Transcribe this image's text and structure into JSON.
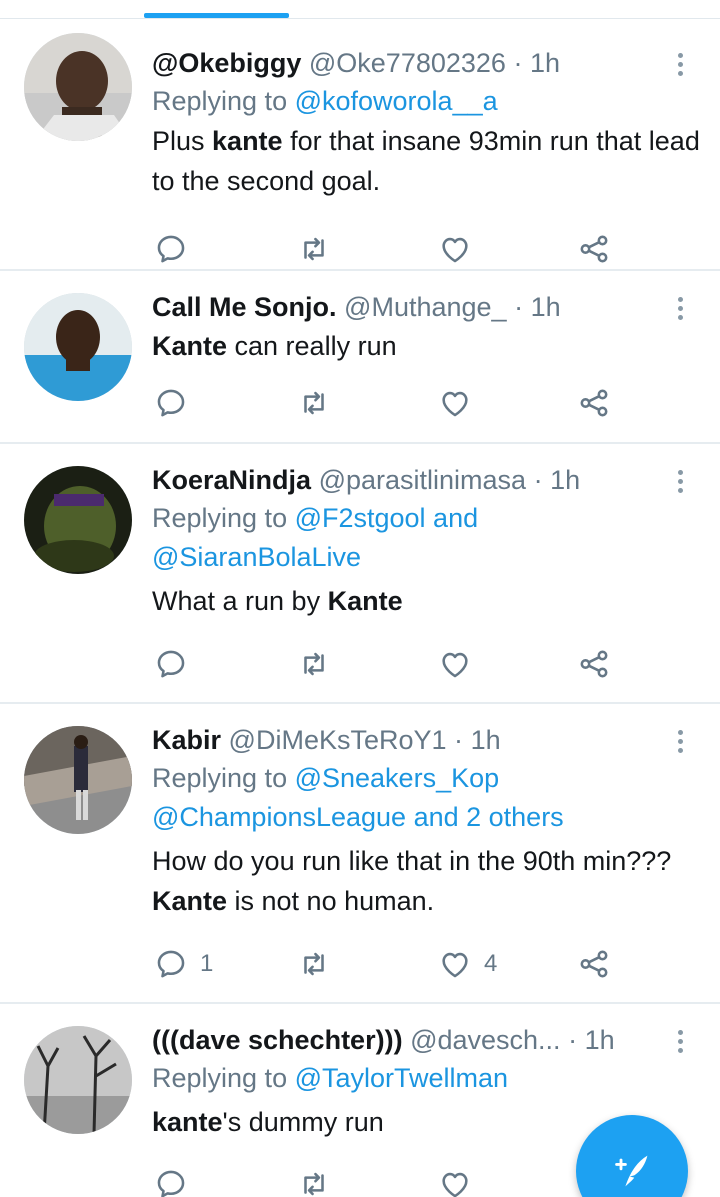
{
  "tweets": [
    {
      "name": "@Okebiggy",
      "handle": "@Oke77802326",
      "sep": "·",
      "time": "1h",
      "reply_prefix": "Replying to ",
      "reply_mentions_1": "@kofoworola__a",
      "reply_mentions_2": "",
      "body_pre": "Plus ",
      "body_bold": "kante",
      "body_post": " for that insane 93min run that lead to the second goal.",
      "reply_count": "",
      "like_count": ""
    },
    {
      "name": "Call Me Sonjo.",
      "handle": "@Muthange_",
      "sep": "·",
      "time": "1h",
      "reply_prefix": "",
      "reply_mentions_1": "",
      "reply_mentions_2": "",
      "body_pre": "",
      "body_bold": "Kante",
      "body_post": " can really run",
      "reply_count": "",
      "like_count": ""
    },
    {
      "name": "KoeraNindja",
      "handle": "@parasitlinimasa",
      "sep": "·",
      "time": "1h",
      "reply_prefix": "Replying to ",
      "reply_mentions_1": "@F2stgool and",
      "reply_mentions_2": "@SiaranBolaLive",
      "body_pre": "What a run by ",
      "body_bold": "Kante",
      "body_post": "",
      "reply_count": "",
      "like_count": ""
    },
    {
      "name": "Kabir",
      "handle": "@DiMeKsTeRoY1",
      "sep": "·",
      "time": "1h",
      "reply_prefix": "Replying to ",
      "reply_mentions_1": "@Sneakers_Kop",
      "reply_mentions_2": "@ChampionsLeague and 2 others",
      "body_pre": "How do you run like that in the 90th min??? ",
      "body_bold": "Kante",
      "body_post": " is not no human.",
      "reply_count": "1",
      "like_count": "4"
    },
    {
      "name": "(((dave schechter)))",
      "handle": "@davesch...",
      "sep": "·",
      "time": "1h",
      "reply_prefix": "Replying to ",
      "reply_mentions_1": "@TaylorTwellman",
      "reply_mentions_2": "",
      "body_pre": "",
      "body_bold": "kante",
      "body_post": "'s dummy run",
      "reply_count": "",
      "like_count": ""
    }
  ],
  "icons": {
    "reply": "reply-icon",
    "retweet": "retweet-icon",
    "like": "heart-icon",
    "share": "share-icon",
    "more": "more-vertical-icon",
    "compose": "compose-tweet-icon"
  },
  "colors": {
    "accent": "#1da1f2",
    "mention": "#1b95e0",
    "muted": "#657786",
    "text": "#14171a",
    "divider": "#e6ecf0"
  }
}
